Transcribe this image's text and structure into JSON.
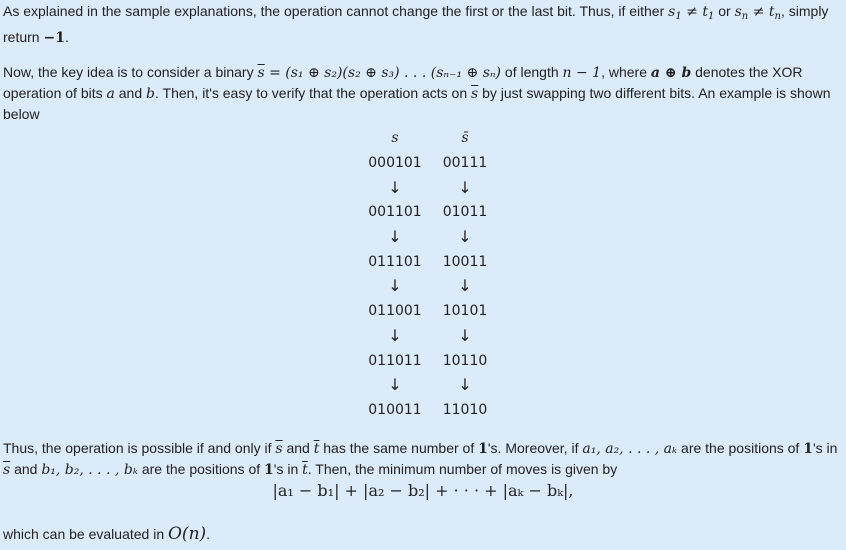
{
  "para1": {
    "a": "As explained in the sample explanations, the operation cannot change the first or the last bit. Thus, if either ",
    "m1": "s",
    "m1sub": "1",
    "neq1": " ≠ ",
    "m2": "t",
    "m2sub": "1",
    "or": " or ",
    "m3": "s",
    "m3sub": "n",
    "neq2": " ≠ ",
    "m4": "t",
    "m4sub": "n",
    "b": ", simply return ",
    "ret": "−1",
    "end": "."
  },
  "para2": {
    "a": "Now, the key idea is to consider a binary ",
    "sbar": "s",
    "eqexpr": " = (s₁ ⊕ s₂)(s₂ ⊕ s₃) . . . (sₙ₋₁ ⊕ sₙ)",
    "b": " of length ",
    "len": "n − 1",
    "c": ", where ",
    "xor": "a ⊕ b",
    "d": " denotes the XOR operation of bits ",
    "va": "a",
    "and": " and ",
    "vb": "b",
    "e": ". Then, it's easy to verify that the operation acts on ",
    "sbar2": "s",
    "f": " by just swapping two different bits. An example is shown below"
  },
  "table": {
    "headers": [
      "s",
      "s̄"
    ],
    "rows": [
      [
        "000101",
        "00111"
      ],
      [
        "001101",
        "01011"
      ],
      [
        "011101",
        "10011"
      ],
      [
        "011001",
        "10101"
      ],
      [
        "011011",
        "10110"
      ],
      [
        "010011",
        "11010"
      ]
    ],
    "arrow": "↓"
  },
  "para3": {
    "a": "Thus, the operation is possible if and only if ",
    "sbar": "s",
    "and1": " and ",
    "tbar": "t",
    "b": " has the same number of ",
    "one": "1",
    "c": "'s. Moreover, if ",
    "alist": "a₁, a₂, . . . , aₖ",
    "d": " are the positions of ",
    "one2": "1",
    "e": "'s in ",
    "sbar2": "s",
    "and2": " and ",
    "blist": "b₁, b₂, . . . , bₖ",
    "f": " are the positions of ",
    "one3": "1",
    "g": "'s in ",
    "tbar2": "t",
    "h": ". Then, the minimum number of moves is given by"
  },
  "formula": "|a₁ − b₁| + |a₂ − b₂| + · · · + |aₖ − bₖ|,",
  "para4": {
    "a": "which can be evaluated in ",
    "big": "O(n)",
    "end": "."
  }
}
